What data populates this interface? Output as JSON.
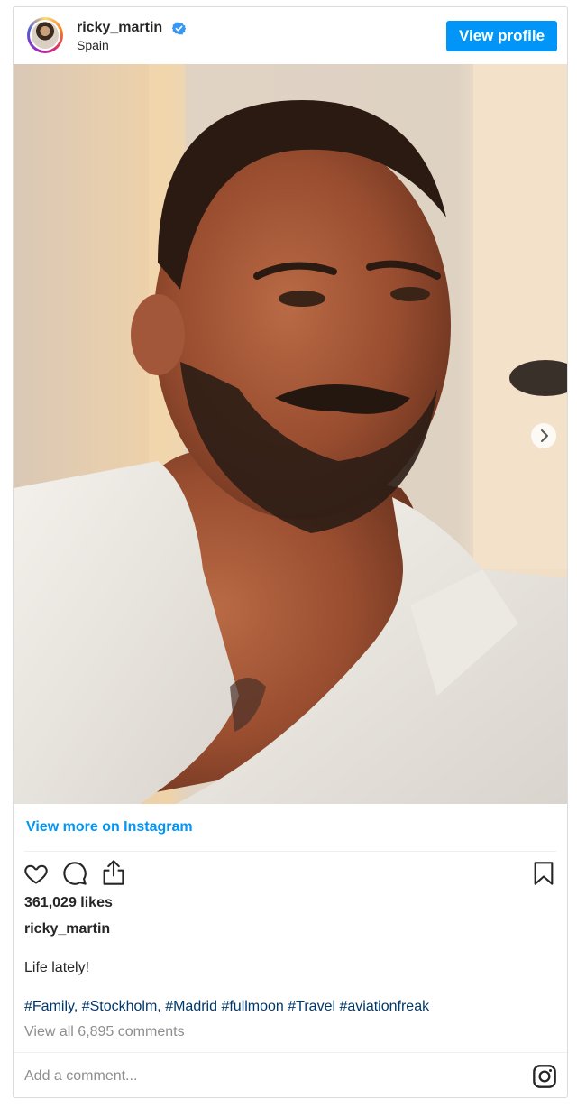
{
  "header": {
    "username": "ricky_martin",
    "location": "Spain",
    "verified_icon": "verified-badge-icon",
    "view_profile_label": "View profile"
  },
  "post": {
    "view_more_label": "View more on Instagram",
    "likes": "361,029 likes",
    "caption_username": "ricky_martin",
    "caption": "Life lately!",
    "hashtags": "#Family, #Stockholm, #Madrid #fullmoon #Travel #aviationfreak",
    "view_comments": "View all 6,895 comments",
    "comment_placeholder": "Add a comment..."
  },
  "icons": {
    "like": "heart-icon",
    "comment": "comment-bubble-icon",
    "share": "share-icon",
    "save": "bookmark-icon",
    "instagram": "instagram-logo-icon",
    "next": "chevron-right-icon"
  },
  "colors": {
    "accent": "#0095f6",
    "hashtag": "#00376b",
    "muted": "#8e8e8e",
    "text": "#262626"
  }
}
